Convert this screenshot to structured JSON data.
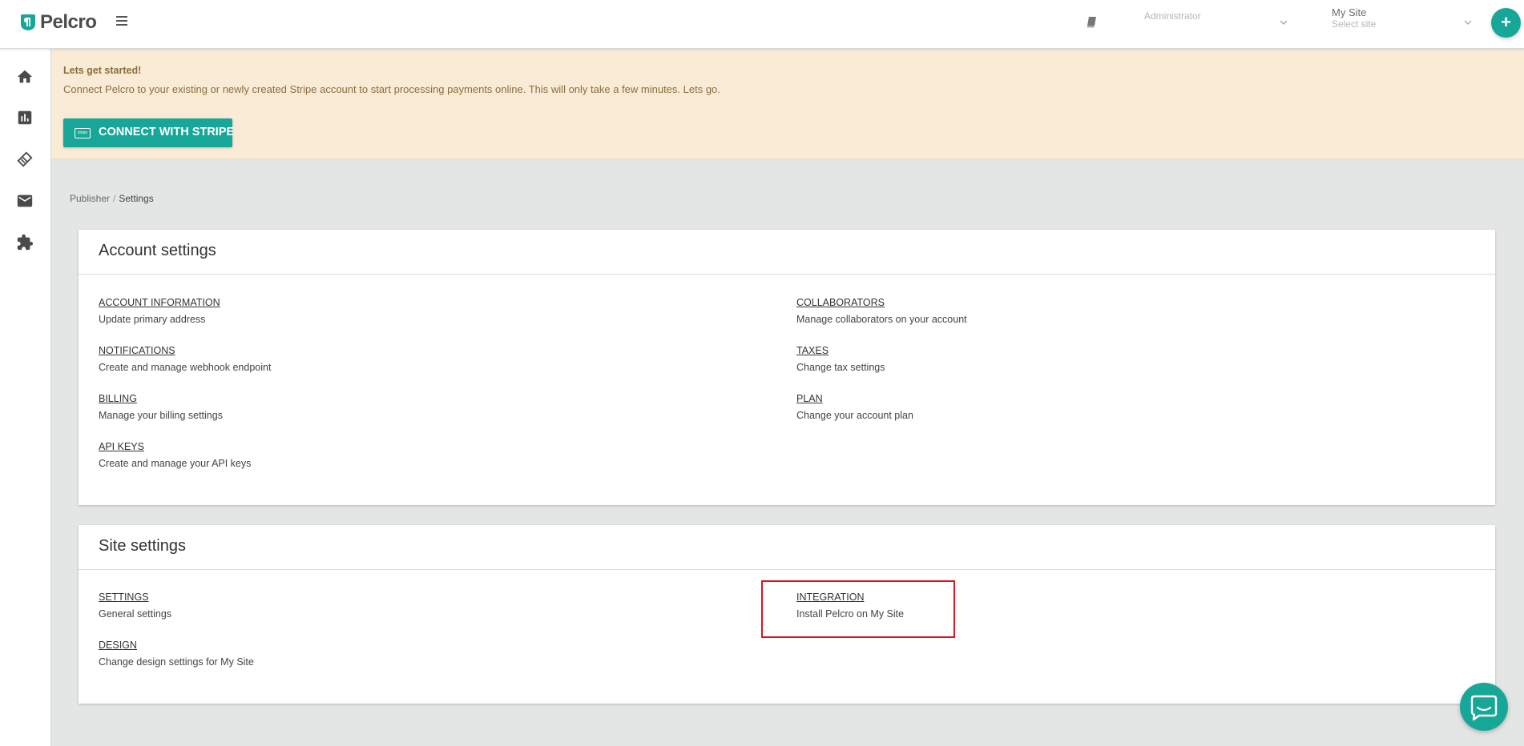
{
  "header": {
    "logo_text": "Pelcro",
    "role_select": {
      "value": "Administrator"
    },
    "site_select": {
      "label": "My Site",
      "placeholder": "Select site"
    },
    "add_button": "+"
  },
  "sidebar": {
    "items": [
      {
        "icon": "home-icon"
      },
      {
        "icon": "chart-icon"
      },
      {
        "icon": "ticket-icon"
      },
      {
        "icon": "mail-icon"
      },
      {
        "icon": "puzzle-icon"
      }
    ]
  },
  "banner": {
    "title": "Lets get started!",
    "text": "Connect Pelcro to your existing or newly created Stripe account to start processing payments online. This will only take a few minutes. Lets go.",
    "stripe_badge": "stripe",
    "button": "CONNECT WITH STRIPE"
  },
  "breadcrumb": {
    "parent": "Publisher",
    "separator": "/",
    "current": "Settings"
  },
  "account_settings": {
    "title": "Account settings",
    "items": [
      {
        "link": "ACCOUNT INFORMATION",
        "desc": "Update primary address"
      },
      {
        "link": "COLLABORATORS",
        "desc": "Manage collaborators on your account"
      },
      {
        "link": "NOTIFICATIONS",
        "desc": "Create and manage webhook endpoint"
      },
      {
        "link": "TAXES",
        "desc": "Change tax settings"
      },
      {
        "link": "BILLING",
        "desc": "Manage your billing settings"
      },
      {
        "link": "PLAN",
        "desc": "Change your account plan"
      },
      {
        "link": "API KEYS",
        "desc": "Create and manage your API keys"
      }
    ]
  },
  "site_settings": {
    "title": "Site settings",
    "items": [
      {
        "link": "SETTINGS",
        "desc": "General settings"
      },
      {
        "link": "INTEGRATION",
        "desc": "Install Pelcro on My Site"
      },
      {
        "link": "DESIGN",
        "desc": "Change design settings for My Site"
      }
    ]
  },
  "colors": {
    "accent": "#17a799",
    "banner_bg": "#faebd7",
    "banner_text": "#8a6d3b",
    "highlight": "#e0121c"
  }
}
